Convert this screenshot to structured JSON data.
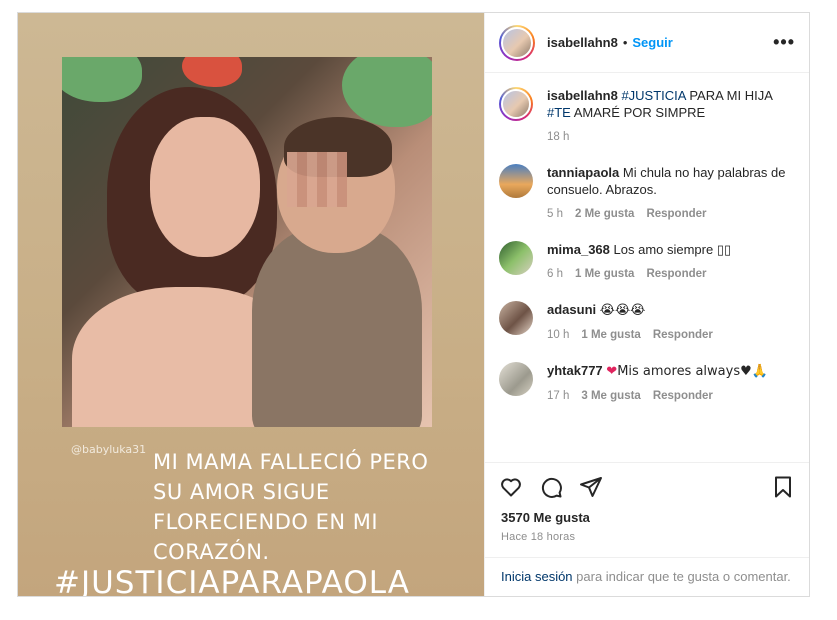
{
  "post": {
    "username": "isabellahn8",
    "follow_label": "Seguir",
    "separator": "•",
    "more_label": "•••"
  },
  "media": {
    "handle": "@babyluka31",
    "caption_lines": [
      "MI MAMA FALLECIÓ PERO",
      "SU AMOR SIGUE",
      "FLORECIENDO EN MI",
      "CORAZÓN."
    ],
    "hashtag": "#JUSTICIAPARAPAOLA"
  },
  "caption": {
    "username": "isabellahn8",
    "tag1": "#JUSTICIA",
    "text1": " PARA MI HIJA",
    "tag2": "#TE",
    "text2": " AMARÉ POR SIMPRE",
    "time": "18 h"
  },
  "comments": [
    {
      "user": "tanniapaola",
      "text": "Mi chula no hay palabras de consuelo. Abrazos.",
      "time": "5 h",
      "likes": "2 Me gusta",
      "reply": "Responder"
    },
    {
      "user": "mima_368",
      "text": "Los amo siempre ▯▯",
      "time": "6 h",
      "likes": "1 Me gusta",
      "reply": "Responder"
    },
    {
      "user": "adasuni",
      "text": "😭😭😭",
      "time": "10 h",
      "likes": "1 Me gusta",
      "reply": "Responder"
    },
    {
      "user": "yhtak777",
      "text_heart": "❤",
      "text": "Mis amores always♥🙏",
      "time": "17 h",
      "likes": "3 Me gusta",
      "reply": "Responder"
    }
  ],
  "stats": {
    "likes": "3570 Me gusta",
    "time": "Hace 18 horas"
  },
  "login": {
    "link": "Inicia sesión",
    "text": " para indicar que te gusta o comentar."
  }
}
